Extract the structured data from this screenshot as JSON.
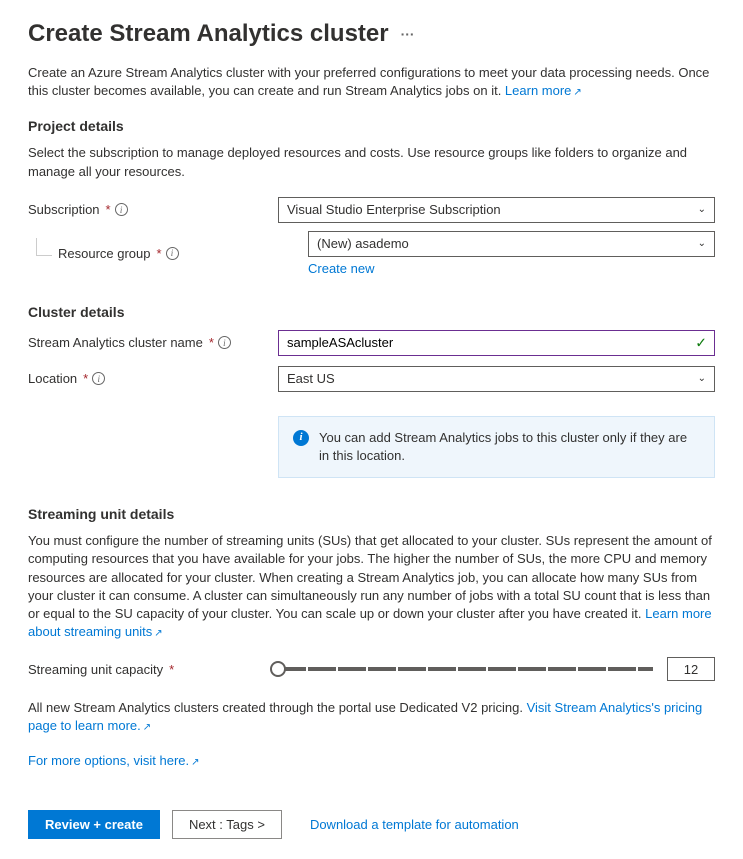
{
  "header": {
    "title": "Create Stream Analytics cluster",
    "intro": "Create an Azure Stream Analytics cluster with your preferred configurations to meet your data processing needs. Once this cluster becomes available, you can create and run Stream Analytics jobs on it. ",
    "learn_more": "Learn more"
  },
  "project": {
    "title": "Project details",
    "desc": "Select the subscription to manage deployed resources and costs. Use resource groups like folders to organize and manage all your resources.",
    "subscription_label": "Subscription",
    "subscription_value": "Visual Studio Enterprise Subscription",
    "resource_group_label": "Resource group",
    "resource_group_value": "(New) asademo",
    "create_new": "Create new"
  },
  "cluster": {
    "title": "Cluster details",
    "name_label": "Stream Analytics cluster name",
    "name_value": "sampleASAcluster",
    "location_label": "Location",
    "location_value": "East US",
    "info_text": "You can add Stream Analytics jobs to this cluster only if they are in this location."
  },
  "streaming": {
    "title": "Streaming unit details",
    "desc": "You must configure the number of streaming units (SUs) that get allocated to your cluster. SUs represent the amount of computing resources that you have available for your jobs. The higher the number of SUs, the more CPU and memory resources are allocated for your cluster. When creating a Stream Analytics job, you can allocate how many SUs from your cluster it can consume. A cluster can simultaneously run any number of jobs with a total SU count that is less than or equal to the SU capacity of your cluster. You can scale up or down your cluster after you have created it. ",
    "learn_more": "Learn more about streaming units",
    "capacity_label": "Streaming unit capacity",
    "capacity_value": "12",
    "pricing_text": "All new Stream Analytics clusters created through the portal use Dedicated V2 pricing. ",
    "pricing_link": "Visit Stream Analytics's pricing page to learn more.",
    "more_options": "For more options, visit here."
  },
  "footer": {
    "review": "Review + create",
    "next": "Next : Tags >",
    "download": "Download a template for automation"
  }
}
